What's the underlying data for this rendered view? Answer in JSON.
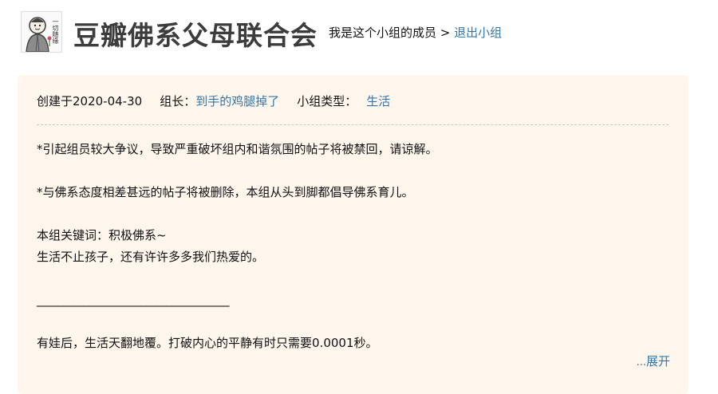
{
  "header": {
    "avatar_text": "一切随缘",
    "group_name": "豆瓣佛系父母联合会",
    "membership_text": "我是这个小组的成员 > ",
    "leave_label": "退出小组"
  },
  "meta": {
    "created_label": "创建于2020-04-30",
    "leader_label": "组长：",
    "leader_name": "到手的鸡腿掉了",
    "type_label": "小组类型：",
    "type_value": "生活"
  },
  "intro": {
    "line1": "*引起组员较大争议，导致严重破坏组内和谐氛围的帖子将被禁回，请谅解。",
    "line2": "*与佛系态度相差甚远的帖子将被删除，本组从头到脚都倡导佛系育儿。",
    "line3": "本组关键词：积极佛系~",
    "line4": "生活不止孩子，还有许许多多我们热爱的。",
    "line5": "_____________________________________",
    "line6": "有娃后，生活天翻地覆。打破内心的平静有时只需要0.0001秒。"
  },
  "expand": {
    "dots": "...",
    "label": "展开"
  }
}
